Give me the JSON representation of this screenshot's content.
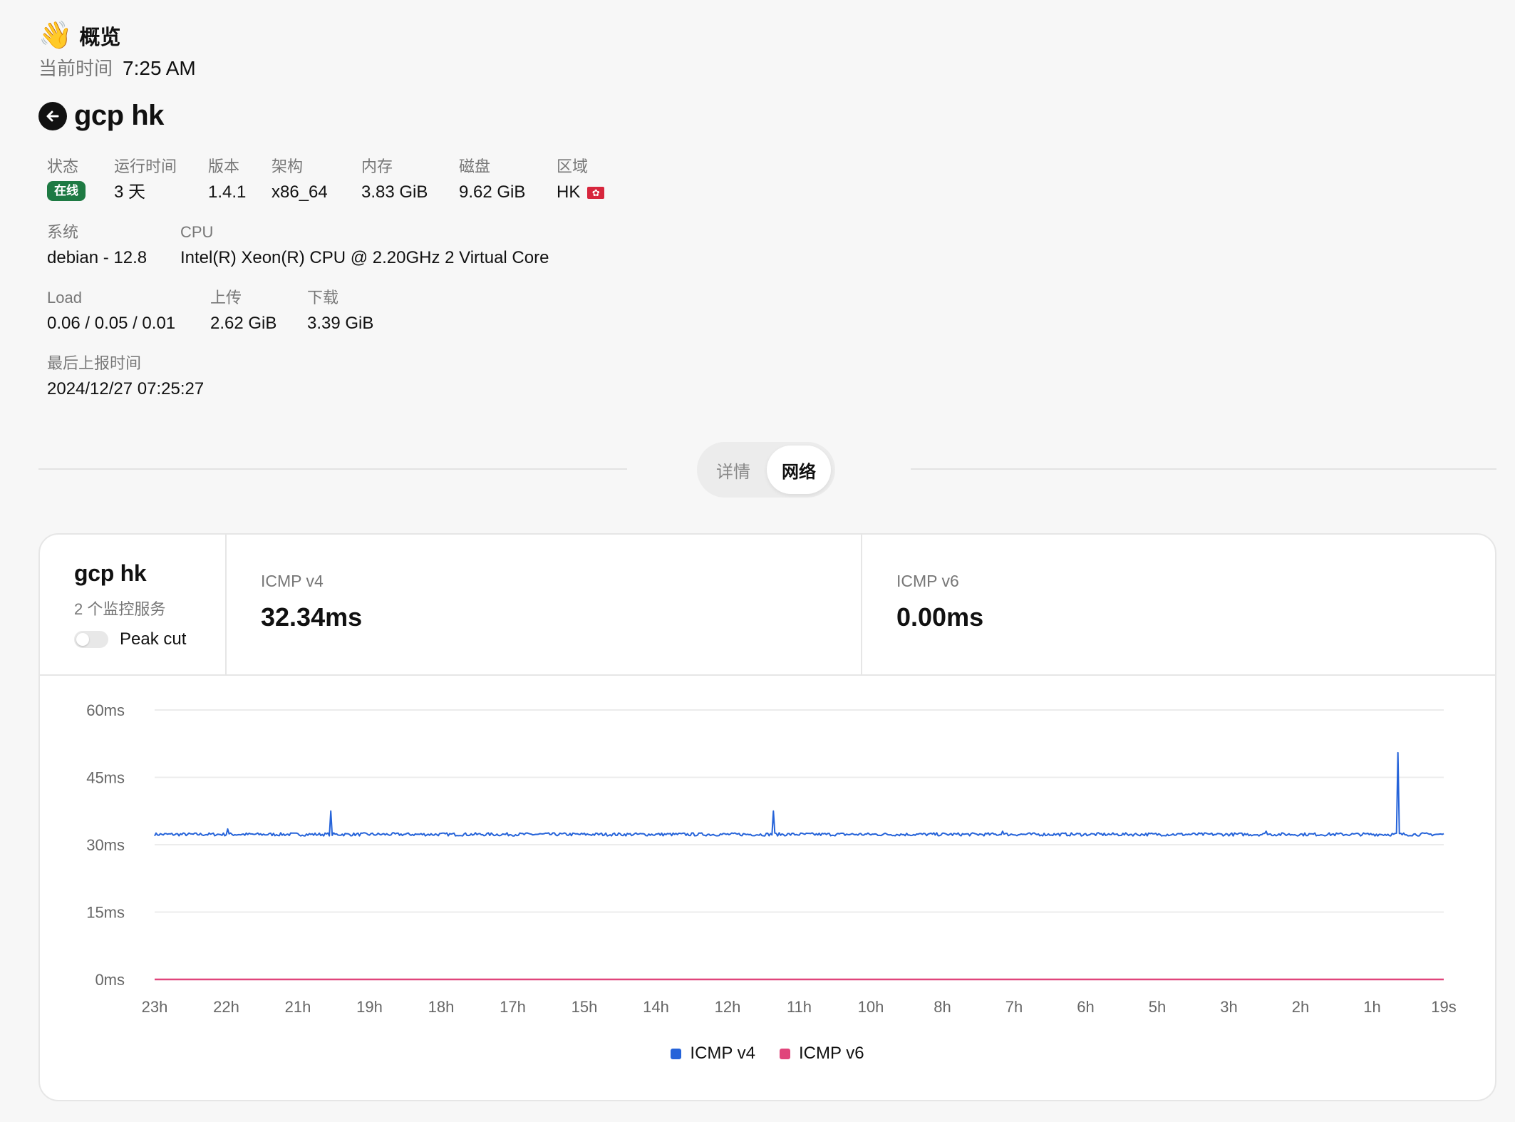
{
  "header": {
    "emoji": "👋",
    "title": "概览",
    "time_label": "当前时间",
    "time_value": "7:25 AM"
  },
  "server": {
    "name": "gcp hk",
    "fields_row1": [
      {
        "label": "状态",
        "badge": "在线"
      },
      {
        "label": "运行时间",
        "value": "3 天"
      },
      {
        "label": "版本",
        "value": "1.4.1"
      },
      {
        "label": "架构",
        "value": "x86_64"
      },
      {
        "label": "内存",
        "value": "3.83 GiB"
      },
      {
        "label": "磁盘",
        "value": "9.62 GiB"
      },
      {
        "label": "区域",
        "value": "HK"
      }
    ],
    "fields_row2": [
      {
        "label": "系统",
        "value": "debian - 12.8"
      },
      {
        "label": "CPU",
        "value": "Intel(R) Xeon(R) CPU @ 2.20GHz 2 Virtual Core"
      }
    ],
    "fields_row3": [
      {
        "label": "Load",
        "value": "0.06 / 0.05 / 0.01"
      },
      {
        "label": "上传",
        "value": "2.62 GiB"
      },
      {
        "label": "下载",
        "value": "3.39 GiB"
      }
    ],
    "fields_row4": [
      {
        "label": "最后上报时间",
        "value": "2024/12/27 07:25:27"
      }
    ]
  },
  "tabs": {
    "detail": "详情",
    "network": "网络",
    "active": "network"
  },
  "network_card": {
    "name": "gcp hk",
    "subtitle": "2 个监控服务",
    "peak_cut_label": "Peak cut",
    "peak_cut_enabled": false,
    "metrics": [
      {
        "label": "ICMP v4",
        "value": "32.34ms"
      },
      {
        "label": "ICMP v6",
        "value": "0.00ms"
      }
    ]
  },
  "colors": {
    "accent_v4": "#2563d9",
    "accent_v6": "#e0457b",
    "online": "#1e7a43"
  },
  "chart_data": {
    "type": "line",
    "y_ticks": [
      "60ms",
      "45ms",
      "30ms",
      "15ms",
      "0ms"
    ],
    "ylim": [
      0,
      60
    ],
    "x_ticks": [
      "23h",
      "22h",
      "21h",
      "19h",
      "18h",
      "17h",
      "15h",
      "14h",
      "12h",
      "11h",
      "10h",
      "8h",
      "7h",
      "6h",
      "5h",
      "3h",
      "2h",
      "1h",
      "19s"
    ],
    "grid": true,
    "legend_position": "bottom",
    "series": [
      {
        "name": "ICMP v4",
        "baseline": 32.3,
        "spikes": [
          {
            "x": 0.057,
            "y": 33.5
          },
          {
            "x": 0.137,
            "y": 37.5
          },
          {
            "x": 0.48,
            "y": 37.5
          },
          {
            "x": 0.658,
            "y": 33
          },
          {
            "x": 0.862,
            "y": 33
          },
          {
            "x": 0.964,
            "y": 50.5
          }
        ]
      },
      {
        "name": "ICMP v6",
        "baseline": 0
      }
    ]
  }
}
